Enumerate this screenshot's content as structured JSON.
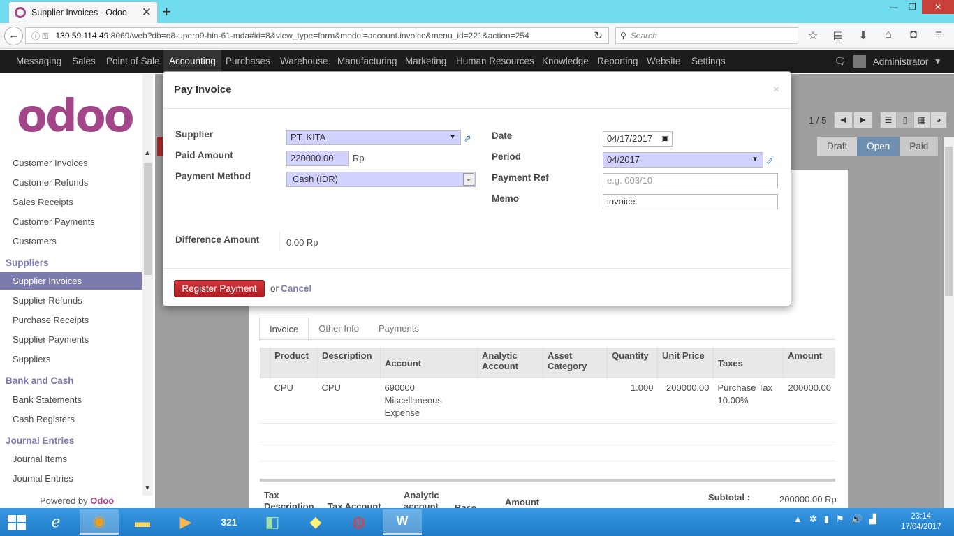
{
  "browser": {
    "tab_title": "Supplier Invoices - Odoo",
    "url_host": "139.59.114.49",
    "url_rest": ":8069/web?db=o8-uperp9-hin-61-mda#id=8&view_type=form&model=account.invoice&menu_id=221&action=254",
    "search_placeholder": "Search"
  },
  "topmenu": {
    "items": [
      "Messaging",
      "Sales",
      "Point of Sale",
      "Accounting",
      "Purchases",
      "Warehouse",
      "Manufacturing",
      "Marketing",
      "Human Resources",
      "Knowledge",
      "Reporting",
      "Website",
      "Settings"
    ],
    "active": "Accounting",
    "user": "Administrator"
  },
  "sidebar": {
    "logo": "odoo",
    "customers": [
      "Customer Invoices",
      "Customer Refunds",
      "Sales Receipts",
      "Customer Payments",
      "Customers"
    ],
    "suppliers_header": "Suppliers",
    "suppliers": [
      "Supplier Invoices",
      "Supplier Refunds",
      "Purchase Receipts",
      "Supplier Payments",
      "Suppliers"
    ],
    "bank_header": "Bank and Cash",
    "bank": [
      "Bank Statements",
      "Cash Registers"
    ],
    "journal_header": "Journal Entries",
    "journal": [
      "Journal Items",
      "Journal Entries"
    ],
    "powered_prefix": "Powered by",
    "powered_brand": "Odoo"
  },
  "form": {
    "pager": "1 / 5",
    "statuses": [
      "Draft",
      "Open",
      "Paid"
    ],
    "current_status": "Open",
    "tabs": [
      "Invoice",
      "Other Info",
      "Payments"
    ],
    "columns": [
      "Product",
      "Description",
      "Account",
      "Analytic Account",
      "Asset Category",
      "Quantity",
      "Unit Price",
      "Taxes",
      "Amount"
    ],
    "rows": [
      {
        "product": "CPU",
        "description": "CPU",
        "account": "690000 Miscellaneous Expense",
        "analytic": "",
        "asset": "",
        "quantity": "1.000",
        "unit_price": "200000.00",
        "taxes": "Purchase Tax 10.00%",
        "amount": "200000.00"
      }
    ],
    "tax_columns": [
      "Tax Description",
      "Tax Account",
      "Analytic account",
      "Base",
      "Amount"
    ],
    "subtotal_label": "Subtotal :",
    "subtotal_value": "200000.00 Rp"
  },
  "modal": {
    "title": "Pay Invoice",
    "close": "×",
    "supplier_label": "Supplier",
    "supplier_value": "PT. KITA",
    "paid_amount_label": "Paid Amount",
    "paid_amount_value": "220000.00",
    "currency": "Rp",
    "payment_method_label": "Payment Method",
    "payment_method_value": "Cash (IDR)",
    "date_label": "Date",
    "date_value": "04/17/2017",
    "period_label": "Period",
    "period_value": "04/2017",
    "payment_ref_label": "Payment Ref",
    "payment_ref_placeholder": "e.g. 003/10",
    "memo_label": "Memo",
    "memo_value": "invoice",
    "difference_label": "Difference Amount",
    "difference_value": "0.00 Rp",
    "register_button": "Register Payment",
    "or_text": "or",
    "cancel_link": "Cancel"
  },
  "taskbar": {
    "time": "23:14",
    "date": "17/04/2017"
  },
  "colors": {
    "odoo_purple": "#7c7bad",
    "register_red": "#c0272d",
    "required_field": "#d2d2ff"
  }
}
